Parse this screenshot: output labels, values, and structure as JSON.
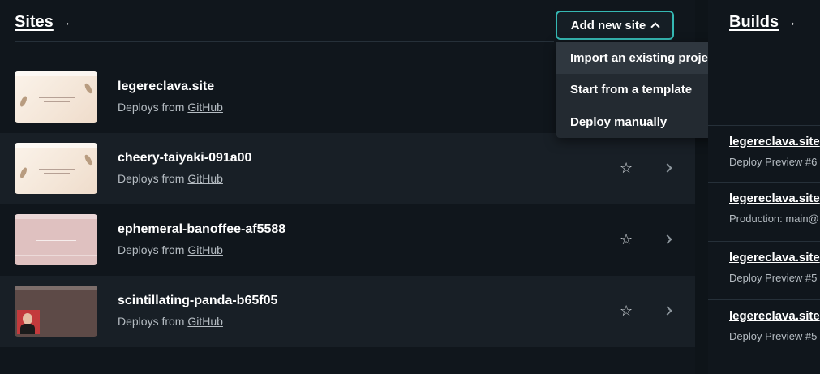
{
  "sites": {
    "title": "Sites",
    "arrow": "→",
    "add_button_label": "Add new site",
    "items": [
      {
        "name": "legereclava.site",
        "deploy_prefix": "Deploys from",
        "deploy_source": "GitHub",
        "thumbnail": "cream"
      },
      {
        "name": "cheery-taiyaki-091a00",
        "deploy_prefix": "Deploys from",
        "deploy_source": "GitHub",
        "thumbnail": "cream"
      },
      {
        "name": "ephemeral-banoffee-af5588",
        "deploy_prefix": "Deploys from",
        "deploy_source": "GitHub",
        "thumbnail": "pink"
      },
      {
        "name": "scintillating-panda-b65f05",
        "deploy_prefix": "Deploys from",
        "deploy_source": "GitHub",
        "thumbnail": "brown"
      }
    ]
  },
  "dropdown": {
    "items": [
      {
        "label": "Import an existing project",
        "icons": [
          "github-icon",
          "gitlab-icon",
          "bitbucket-icon",
          "azure-devops-icon"
        ]
      },
      {
        "label": "Start from a template",
        "icons": [
          "remix-icon",
          "nextjs-icon",
          "nuxt-icon",
          "astro-icon"
        ]
      },
      {
        "label": "Deploy manually",
        "icons": []
      }
    ]
  },
  "builds": {
    "title": "Builds",
    "arrow": "→",
    "items": [
      {
        "name": "legereclava.site",
        "sub": "Deploy Preview #6"
      },
      {
        "name": "legereclava.site",
        "sub": "Production: main@"
      },
      {
        "name": "legereclava.site",
        "sub": "Deploy Preview #5"
      },
      {
        "name": "legereclava.site",
        "sub": "Deploy Preview #5"
      }
    ]
  },
  "colors": {
    "accent": "#35b8b3",
    "background": "#10161c",
    "row_alt": "#181f26",
    "menu_bg": "#232a31"
  }
}
